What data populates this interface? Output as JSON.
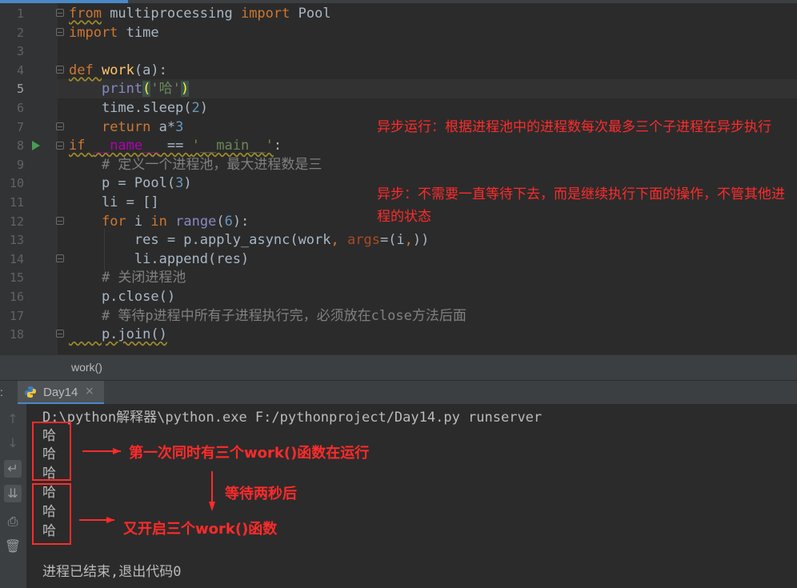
{
  "editor": {
    "line_numbers": [
      "1",
      "2",
      "3",
      "4",
      "5",
      "6",
      "7",
      "8",
      "9",
      "10",
      "11",
      "12",
      "13",
      "14",
      "15",
      "16",
      "17",
      "18"
    ],
    "code": {
      "l1": {
        "kw_from": "from",
        "mod": " multiprocessing ",
        "kw_import": "import",
        "name": " Pool"
      },
      "l2": {
        "kw_import": "import",
        "name": " time"
      },
      "l4": {
        "kw_def": "def ",
        "fn": "work",
        "args": "(a):"
      },
      "l5": {
        "indent": "    ",
        "fn": "print",
        "open": "(",
        "str": "'哈'",
        "close": ")"
      },
      "l6": {
        "text": "    time.sleep(",
        "num": "2",
        "end": ")"
      },
      "l7": {
        "indent": "    ",
        "kw": "return",
        "rest": " a*",
        "num": "3"
      },
      "l8": {
        "kw": "if ",
        "dunder": "__name__",
        "eq": " == ",
        "str": "'__main__'",
        "colon": ":"
      },
      "l9": {
        "comment": "    # 定义一个进程池，最大进程数是三"
      },
      "l10": {
        "text": "    p = Pool(",
        "num": "3",
        "end": ")"
      },
      "l11": {
        "text": "    li = []"
      },
      "l12": {
        "indent": "    ",
        "kw_for": "for",
        "mid": " i ",
        "kw_in": "in",
        "sp": " ",
        "bi": "range",
        "open": "(",
        "num": "6",
        "end": "):"
      },
      "l13": {
        "text": "        res = p.apply_async(work",
        "comma": ", ",
        "param": "args",
        "eq": "=(i",
        "comma2": ",",
        "end": "))"
      },
      "l14": {
        "text": "        li.append(res)"
      },
      "l15": {
        "comment": "    # 关闭进程池"
      },
      "l16": {
        "text": "    p.close()"
      },
      "l17": {
        "comment": "    # 等待p进程中所有子进程执行完，必须放在close方法后面"
      },
      "l18": {
        "text": "    p.join()"
      }
    },
    "annotation1": "异步运行：根据进程池中的进程数每次最多三个子进程在异步执行",
    "annotation2": "异步：不需要一直等待下去，而是继续执行下面的操作，不管其他进程的状态"
  },
  "breadcrumb": "work()",
  "run_panel": {
    "prefix": ":",
    "tab_label": "Day14",
    "tab_close": "×",
    "command": "D:\\python解释器\\python.exe F:/pythonproject/Day14.py runserver",
    "outputs": [
      "哈",
      "哈",
      "哈",
      "哈",
      "哈",
      "哈"
    ],
    "note1": "第一次同时有三个work()函数在运行",
    "note2": "等待两秒后",
    "note3": "又开启三个work()函数",
    "exit_text": "进程已结束,退出代码0"
  },
  "colors": {
    "accent": "#4a88c7",
    "annotation": "#ff2b2b"
  }
}
